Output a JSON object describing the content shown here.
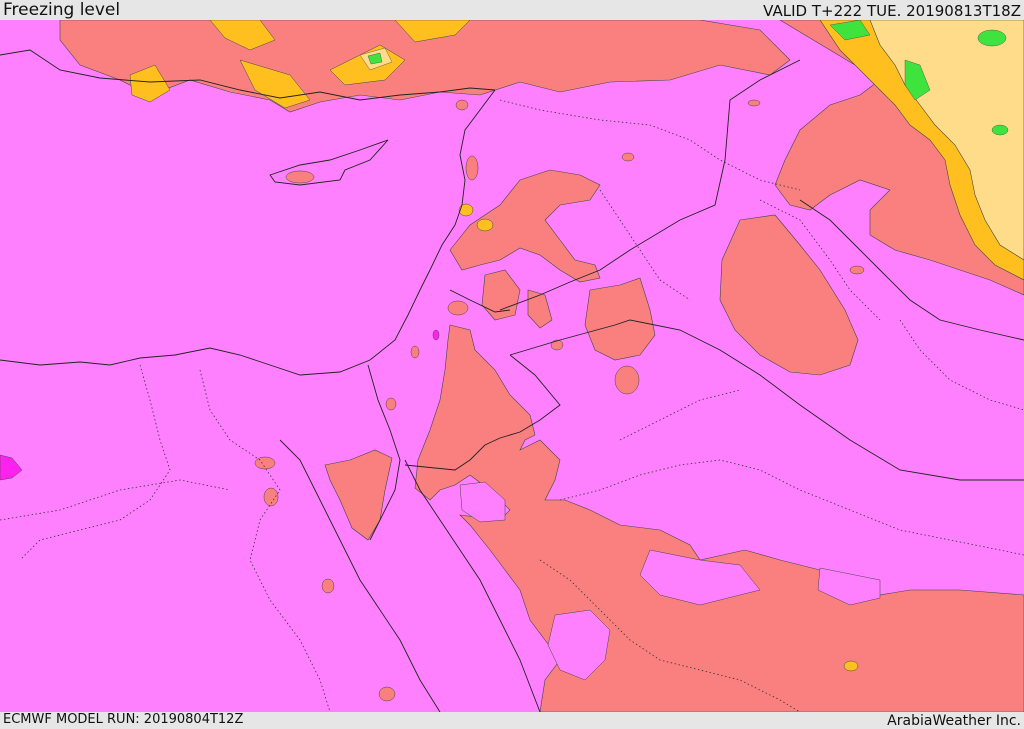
{
  "header": {
    "title": "Freezing level",
    "valid_time": "VALID T+222 TUE. 20190813T18Z"
  },
  "footer": {
    "model_run": "ECMWF MODEL RUN: 20190804T12Z",
    "credit": "ArabiaWeather Inc."
  },
  "colors": {
    "base": "#ff80ff",
    "band_salmon": "#fa8080",
    "band_orange": "#ffbf1f",
    "band_yellow": "#fedc8a",
    "band_green": "#3ee33e",
    "band_magenta": "#ff22ee"
  }
}
